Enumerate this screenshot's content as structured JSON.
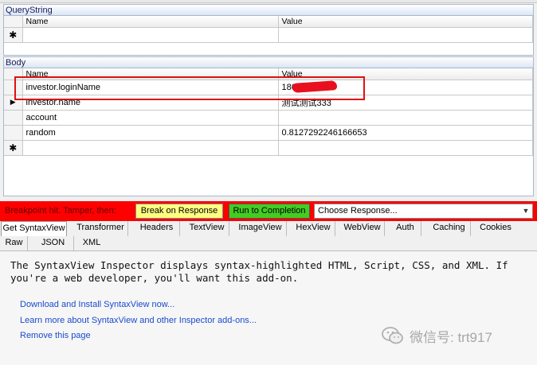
{
  "querystring": {
    "title": "QueryString",
    "col_name": "Name",
    "col_value": "Value",
    "new_row_marker": "✱"
  },
  "body": {
    "title": "Body",
    "col_name": "Name",
    "col_value": "Value",
    "rows": [
      {
        "name": "investor.loginName",
        "value": "1860",
        "redacted": true
      },
      {
        "name": "investor.name",
        "value": "测试测试333",
        "current": true
      },
      {
        "name": "account",
        "value": ""
      },
      {
        "name": "random",
        "value": "0.8127292246166653"
      }
    ],
    "new_row_marker": "✱",
    "current_row_marker": "▶"
  },
  "breakpoint": {
    "label": "Breakpoint hit. Tamper, then:",
    "break_on_response": "Break on Response",
    "run_to_completion": "Run to Completion",
    "choose_response": "Choose Response..."
  },
  "tabs_row1": [
    "Get SyntaxView",
    "Transformer",
    "Headers",
    "TextView",
    "ImageView",
    "HexView",
    "WebView",
    "Auth",
    "Caching",
    "Cookies"
  ],
  "tabs_row2": [
    "Raw",
    "JSON",
    "XML"
  ],
  "content": {
    "line1": "The SyntaxView Inspector displays syntax-highlighted HTML, Script, CSS, and XML. If",
    "line2": "you're a web developer, you'll want this add-on.",
    "links": [
      "Download and Install SyntaxView now...",
      "Learn more about SyntaxView and other Inspector add-ons...",
      "Remove this page"
    ]
  },
  "watermark": "微信号: trt917",
  "colors": {
    "breakpoint_bar": "#ff0000",
    "break_button": "#ffff80",
    "run_button": "#44cc22",
    "link": "#1a4bcc",
    "highlight_box": "#e01010"
  }
}
